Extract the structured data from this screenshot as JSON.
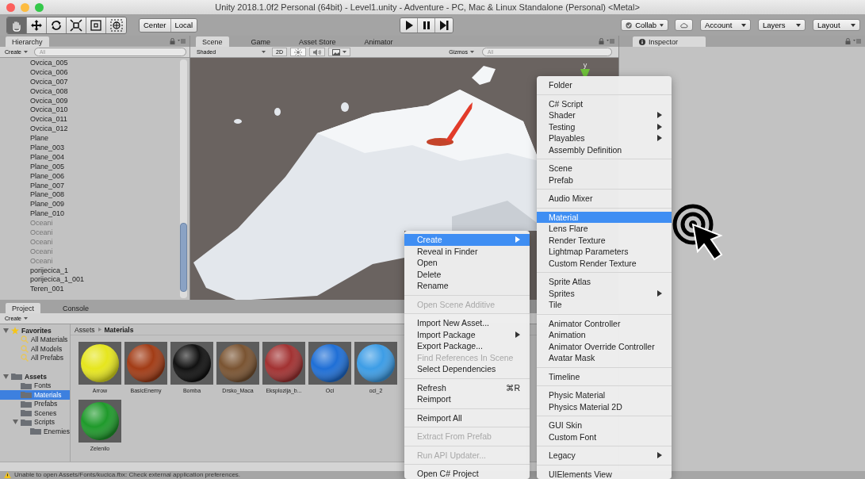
{
  "window": {
    "title": "Unity 2018.1.0f2 Personal (64bit) - Level1.unity - Adventure - PC, Mac & Linux Standalone (Personal) <Metal>"
  },
  "toolbar": {
    "tools": [
      {
        "selected": true
      },
      {
        "selected": false
      },
      {
        "selected": false
      },
      {
        "selected": false
      },
      {
        "selected": false
      },
      {
        "selected": false
      }
    ],
    "pivot_buttons": [
      "Center",
      "Local"
    ],
    "collab": "Collab",
    "account": "Account",
    "layers": "Layers",
    "layout": "Layout"
  },
  "hierarchy": {
    "tab": "Hierarchy",
    "create": "Create",
    "search_placeholder": "All",
    "items": [
      {
        "label": "Ovcica_005",
        "disabled": false
      },
      {
        "label": "Ovcica_006",
        "disabled": false
      },
      {
        "label": "Ovcica_007",
        "disabled": false
      },
      {
        "label": "Ovcica_008",
        "disabled": false
      },
      {
        "label": "Ovcica_009",
        "disabled": false
      },
      {
        "label": "Ovcica_010",
        "disabled": false
      },
      {
        "label": "Ovcica_011",
        "disabled": false
      },
      {
        "label": "Ovcica_012",
        "disabled": false
      },
      {
        "label": "Plane",
        "disabled": false
      },
      {
        "label": "Plane_003",
        "disabled": false
      },
      {
        "label": "Plane_004",
        "disabled": false
      },
      {
        "label": "Plane_005",
        "disabled": false
      },
      {
        "label": "Plane_006",
        "disabled": false
      },
      {
        "label": "Plane_007",
        "disabled": false
      },
      {
        "label": "Plane_008",
        "disabled": false
      },
      {
        "label": "Plane_009",
        "disabled": false
      },
      {
        "label": "Plane_010",
        "disabled": false
      },
      {
        "label": "Oceani",
        "disabled": true
      },
      {
        "label": "Oceani",
        "disabled": true
      },
      {
        "label": "Oceani",
        "disabled": true
      },
      {
        "label": "Oceani",
        "disabled": true
      },
      {
        "label": "Oceani",
        "disabled": true
      },
      {
        "label": "porijecica_1",
        "disabled": false
      },
      {
        "label": "porijecica_1_001",
        "disabled": false
      },
      {
        "label": "Teren_001",
        "disabled": false
      }
    ]
  },
  "scene": {
    "tabs": [
      {
        "label": "Scene",
        "selected": true
      },
      {
        "label": "Game",
        "selected": false
      },
      {
        "label": "Asset Store",
        "selected": false
      },
      {
        "label": "Animator",
        "selected": false
      }
    ],
    "shading": "Shaded",
    "mode_2d": "2D",
    "toggles": [
      {
        "on": true
      },
      {
        "on": false
      }
    ],
    "gizmos": "Gizmos",
    "search_placeholder": "All",
    "axis_label": "y"
  },
  "inspector": {
    "tab": "Inspector"
  },
  "project": {
    "tabs": [
      {
        "label": "Project",
        "selected": true
      },
      {
        "label": "Console",
        "selected": false
      }
    ],
    "create": "Create",
    "tree": [
      {
        "label": "Favorites",
        "kind": "favorites",
        "expanded": true,
        "selected": false,
        "children": [
          {
            "label": "All Materials",
            "kind": "search",
            "selected": false
          },
          {
            "label": "All Models",
            "kind": "search",
            "selected": false
          },
          {
            "label": "All Prefabs",
            "kind": "search",
            "selected": false
          }
        ]
      },
      {
        "label": "Assets",
        "kind": "folder",
        "expanded": true,
        "selected": false,
        "children": [
          {
            "label": "Fonts",
            "kind": "folder",
            "selected": false
          },
          {
            "label": "Materials",
            "kind": "folder",
            "selected": true
          },
          {
            "label": "Prefabs",
            "kind": "folder",
            "selected": false
          },
          {
            "label": "Scenes",
            "kind": "folder",
            "selected": false
          },
          {
            "label": "Scripts",
            "kind": "folder",
            "expanded": true,
            "selected": false,
            "children": [
              {
                "label": "Enemies",
                "kind": "folder",
                "selected": false
              }
            ]
          }
        ]
      }
    ],
    "breadcrumb": [
      "Assets",
      "Materials"
    ],
    "materials": [
      {
        "name": "Arrow",
        "color": "#e6e61e"
      },
      {
        "name": "BasicEnemy",
        "color": "#a23c16"
      },
      {
        "name": "Bomba",
        "color": "#111111"
      },
      {
        "name": "Drsko_Maca",
        "color": "#7a5432"
      },
      {
        "name": "Eksplozija_b...",
        "color": "#a23232"
      },
      {
        "name": "Oci",
        "color": "#1f6fd6"
      },
      {
        "name": "oci_2",
        "color": "#3d9de6"
      },
      {
        "name": "Zelenilo",
        "color": "#1f9a2b"
      }
    ]
  },
  "context_menu": {
    "sections": [
      [
        {
          "label": "Create",
          "selected": true,
          "disabled": false,
          "submenu": true
        },
        {
          "label": "Reveal in Finder",
          "selected": false,
          "disabled": false,
          "submenu": false
        },
        {
          "label": "Open",
          "selected": false,
          "disabled": false,
          "submenu": false
        },
        {
          "label": "Delete",
          "selected": false,
          "disabled": false,
          "submenu": false
        },
        {
          "label": "Rename",
          "selected": false,
          "disabled": false,
          "submenu": false
        }
      ],
      [
        {
          "label": "Open Scene Additive",
          "selected": false,
          "disabled": true,
          "submenu": false
        }
      ],
      [
        {
          "label": "Import New Asset...",
          "selected": false,
          "disabled": false,
          "submenu": false
        },
        {
          "label": "Import Package",
          "selected": false,
          "disabled": false,
          "submenu": true
        },
        {
          "label": "Export Package...",
          "selected": false,
          "disabled": false,
          "submenu": false
        },
        {
          "label": "Find References In Scene",
          "selected": false,
          "disabled": true,
          "submenu": false
        },
        {
          "label": "Select Dependencies",
          "selected": false,
          "disabled": false,
          "submenu": false
        }
      ],
      [
        {
          "label": "Refresh",
          "shortcut": "⌘R",
          "selected": false,
          "disabled": false,
          "submenu": false
        },
        {
          "label": "Reimport",
          "selected": false,
          "disabled": false,
          "submenu": false
        }
      ],
      [
        {
          "label": "Reimport All",
          "selected": false,
          "disabled": false,
          "submenu": false
        }
      ],
      [
        {
          "label": "Extract From Prefab",
          "selected": false,
          "disabled": true,
          "submenu": false
        }
      ],
      [
        {
          "label": "Run API Updater...",
          "selected": false,
          "disabled": true,
          "submenu": false
        }
      ],
      [
        {
          "label": "Open C# Project",
          "selected": false,
          "disabled": false,
          "submenu": false
        }
      ]
    ]
  },
  "create_submenu": {
    "sections": [
      [
        {
          "label": "Folder",
          "selected": false,
          "disabled": false,
          "submenu": false
        }
      ],
      [
        {
          "label": "C# Script",
          "selected": false,
          "disabled": false,
          "submenu": false
        },
        {
          "label": "Shader",
          "selected": false,
          "disabled": false,
          "submenu": true
        },
        {
          "label": "Testing",
          "selected": false,
          "disabled": false,
          "submenu": true
        },
        {
          "label": "Playables",
          "selected": false,
          "disabled": false,
          "submenu": true
        },
        {
          "label": "Assembly Definition",
          "selected": false,
          "disabled": false,
          "submenu": false
        }
      ],
      [
        {
          "label": "Scene",
          "selected": false,
          "disabled": false,
          "submenu": false
        },
        {
          "label": "Prefab",
          "selected": false,
          "disabled": false,
          "submenu": false
        }
      ],
      [
        {
          "label": "Audio Mixer",
          "selected": false,
          "disabled": false,
          "submenu": false
        }
      ],
      [
        {
          "label": "Material",
          "selected": true,
          "disabled": false,
          "submenu": false
        },
        {
          "label": "Lens Flare",
          "selected": false,
          "disabled": false,
          "submenu": false
        },
        {
          "label": "Render Texture",
          "selected": false,
          "disabled": false,
          "submenu": false
        },
        {
          "label": "Lightmap Parameters",
          "selected": false,
          "disabled": false,
          "submenu": false
        },
        {
          "label": "Custom Render Texture",
          "selected": false,
          "disabled": false,
          "submenu": false
        }
      ],
      [
        {
          "label": "Sprite Atlas",
          "selected": false,
          "disabled": false,
          "submenu": false
        },
        {
          "label": "Sprites",
          "selected": false,
          "disabled": false,
          "submenu": true
        },
        {
          "label": "Tile",
          "selected": false,
          "disabled": false,
          "submenu": false
        }
      ],
      [
        {
          "label": "Animator Controller",
          "selected": false,
          "disabled": false,
          "submenu": false
        },
        {
          "label": "Animation",
          "selected": false,
          "disabled": false,
          "submenu": false
        },
        {
          "label": "Animator Override Controller",
          "selected": false,
          "disabled": false,
          "submenu": false
        },
        {
          "label": "Avatar Mask",
          "selected": false,
          "disabled": false,
          "submenu": false
        }
      ],
      [
        {
          "label": "Timeline",
          "selected": false,
          "disabled": false,
          "submenu": false
        }
      ],
      [
        {
          "label": "Physic Material",
          "selected": false,
          "disabled": false,
          "submenu": false
        },
        {
          "label": "Physics Material 2D",
          "selected": false,
          "disabled": false,
          "submenu": false
        }
      ],
      [
        {
          "label": "GUI Skin",
          "selected": false,
          "disabled": false,
          "submenu": false
        },
        {
          "label": "Custom Font",
          "selected": false,
          "disabled": false,
          "submenu": false
        }
      ],
      [
        {
          "label": "Legacy",
          "selected": false,
          "disabled": false,
          "submenu": true
        }
      ],
      [
        {
          "label": "UIElements View",
          "selected": false,
          "disabled": false,
          "submenu": false
        }
      ]
    ]
  },
  "status_bar": {
    "message": "Unable to open Assets/Fonts/kucica.fbx: Check external application preferences."
  }
}
